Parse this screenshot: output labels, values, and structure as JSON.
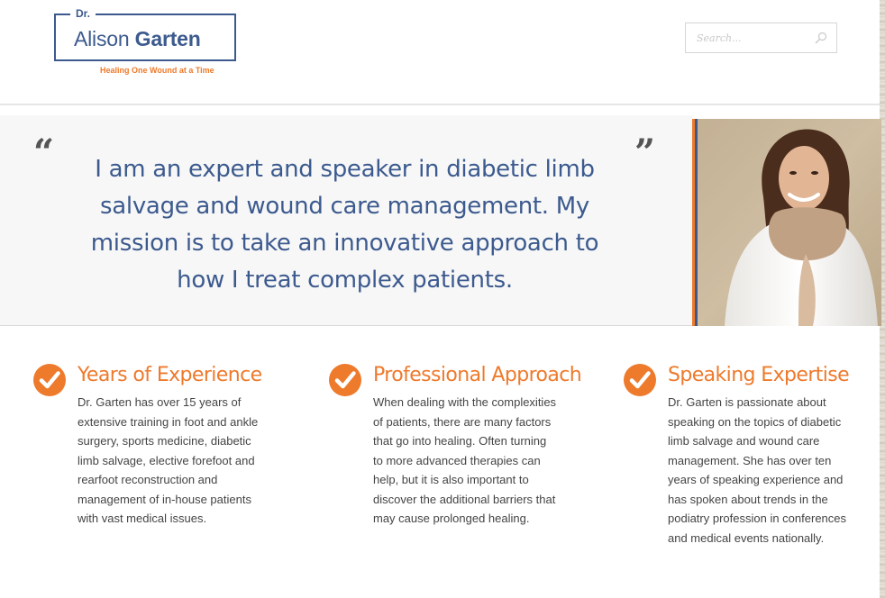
{
  "header": {
    "logo": {
      "prefix": "Dr.",
      "first_name": "Alison",
      "last_name": "Garten",
      "tagline": "Healing One Wound at a Time"
    },
    "search": {
      "placeholder": "Search..."
    }
  },
  "hero": {
    "quote_open": "“",
    "quote_close": "”",
    "quote": "I am an expert and speaker in diabetic limb salvage and wound care management. My mission is to take an innovative approach to how I treat complex patients."
  },
  "features": [
    {
      "title": "Years of Experience",
      "body": "Dr. Garten has over 15 years of extensive training in foot and ankle surgery, sports medicine, diabetic limb salvage, elective forefoot and rearfoot reconstruction and management of in-house patients with vast medical issues."
    },
    {
      "title": "Professional Approach",
      "body": "When dealing with the complexities of patients, there are many factors that go into healing. Often turning to more advanced therapies can help, but it is also important to discover the additional barriers that may cause prolonged healing."
    },
    {
      "title": "Speaking Expertise",
      "body": "Dr. Garten is passionate about speaking on the topics of diabetic limb salvage and wound care management. She has over ten years of speaking experience and has spoken about trends in the podiatry profession in conferences and medical events nationally."
    }
  ],
  "colors": {
    "brand_blue": "#3c5a8e",
    "accent_orange": "#ee7a2c",
    "body_text": "#444444"
  },
  "icons": {
    "search": "search-icon",
    "feature": "checkmark-circle-icon"
  }
}
